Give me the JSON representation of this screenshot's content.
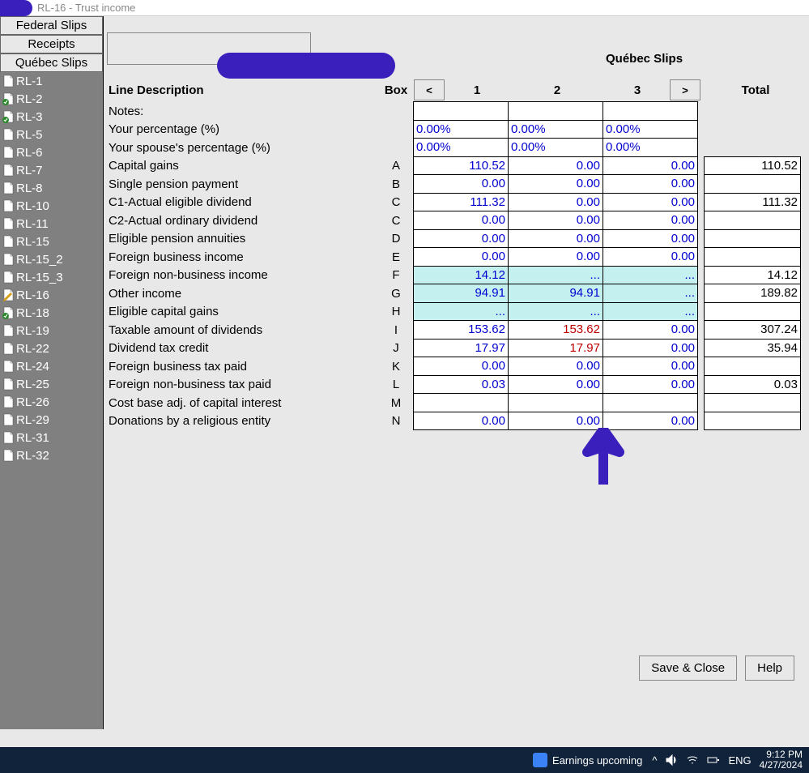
{
  "window": {
    "title": "RL-16  -  Trust income"
  },
  "sidebar": {
    "buttons": [
      {
        "label": "Federal Slips"
      },
      {
        "label": "Receipts"
      },
      {
        "label": "Québec Slips"
      }
    ],
    "items": [
      {
        "label": "RL-1",
        "state": "plain"
      },
      {
        "label": "RL-2",
        "state": "check"
      },
      {
        "label": "RL-3",
        "state": "check"
      },
      {
        "label": "RL-5",
        "state": "plain"
      },
      {
        "label": "RL-6",
        "state": "plain"
      },
      {
        "label": "RL-7",
        "state": "plain"
      },
      {
        "label": "RL-8",
        "state": "plain"
      },
      {
        "label": "RL-10",
        "state": "plain"
      },
      {
        "label": "RL-11",
        "state": "plain"
      },
      {
        "label": "RL-15",
        "state": "plain"
      },
      {
        "label": "RL-15_2",
        "state": "plain"
      },
      {
        "label": "RL-15_3",
        "state": "plain"
      },
      {
        "label": "RL-16",
        "state": "edit"
      },
      {
        "label": "RL-18",
        "state": "check"
      },
      {
        "label": "RL-19",
        "state": "plain"
      },
      {
        "label": "RL-22",
        "state": "plain"
      },
      {
        "label": "RL-24",
        "state": "plain"
      },
      {
        "label": "RL-25",
        "state": "plain"
      },
      {
        "label": "RL-26",
        "state": "plain"
      },
      {
        "label": "RL-29",
        "state": "plain"
      },
      {
        "label": "RL-31",
        "state": "plain"
      },
      {
        "label": "RL-32",
        "state": "plain"
      }
    ]
  },
  "header": {
    "slips_title": "Québec Slips",
    "desc_header": "Line Description",
    "box_header": "Box",
    "prev": "<",
    "next": ">",
    "cols": [
      "1",
      "2",
      "3"
    ],
    "total_header": "Total"
  },
  "rows": [
    {
      "desc": "Notes:",
      "box": "",
      "cells": [
        {
          "v": "",
          "t": "empty"
        },
        {
          "v": "",
          "t": "empty"
        },
        {
          "v": "",
          "t": "empty"
        }
      ],
      "total": ""
    },
    {
      "desc": "Your percentage (%)",
      "box": "",
      "cells": [
        {
          "v": "0.00%",
          "t": "left"
        },
        {
          "v": "0.00%",
          "t": "left"
        },
        {
          "v": "0.00%",
          "t": "left"
        }
      ],
      "total": ""
    },
    {
      "desc": "Your spouse's percentage (%)",
      "box": "",
      "cells": [
        {
          "v": "0.00%",
          "t": "left"
        },
        {
          "v": "0.00%",
          "t": "left"
        },
        {
          "v": "0.00%",
          "t": "left"
        }
      ],
      "total": ""
    },
    {
      "desc": "Capital gains",
      "box": "A",
      "cells": [
        {
          "v": "110.52"
        },
        {
          "v": "0.00"
        },
        {
          "v": "0.00"
        }
      ],
      "total": "110.52"
    },
    {
      "desc": "Single pension payment",
      "box": "B",
      "cells": [
        {
          "v": "0.00"
        },
        {
          "v": "0.00"
        },
        {
          "v": "0.00"
        }
      ],
      "total": ""
    },
    {
      "desc": "C1-Actual eligible dividend",
      "box": "C",
      "cells": [
        {
          "v": "111.32"
        },
        {
          "v": "0.00"
        },
        {
          "v": "0.00"
        }
      ],
      "total": "111.32"
    },
    {
      "desc": "C2-Actual ordinary dividend",
      "box": "C",
      "cells": [
        {
          "v": "0.00"
        },
        {
          "v": "0.00"
        },
        {
          "v": "0.00"
        }
      ],
      "total": ""
    },
    {
      "desc": "Eligible pension annuities",
      "box": "D",
      "cells": [
        {
          "v": "0.00"
        },
        {
          "v": "0.00"
        },
        {
          "v": "0.00"
        }
      ],
      "total": ""
    },
    {
      "desc": "Foreign business income",
      "box": "E",
      "cells": [
        {
          "v": "0.00"
        },
        {
          "v": "0.00"
        },
        {
          "v": "0.00"
        }
      ],
      "total": ""
    },
    {
      "desc": "Foreign non-business income",
      "box": "F",
      "cells": [
        {
          "v": "14.12",
          "t": "hl"
        },
        {
          "v": "...",
          "t": "hl"
        },
        {
          "v": "...",
          "t": "hl"
        }
      ],
      "total": "14.12"
    },
    {
      "desc": "Other income",
      "box": "G",
      "cells": [
        {
          "v": "94.91",
          "t": "hl"
        },
        {
          "v": "94.91",
          "t": "hl"
        },
        {
          "v": "...",
          "t": "hl"
        }
      ],
      "total": "189.82"
    },
    {
      "desc": "Eligible capital gains",
      "box": "H",
      "cells": [
        {
          "v": "...",
          "t": "hl"
        },
        {
          "v": "...",
          "t": "hl"
        },
        {
          "v": "...",
          "t": "hl"
        }
      ],
      "total": ""
    },
    {
      "desc": "Taxable amount of dividends",
      "box": "I",
      "cells": [
        {
          "v": "153.62"
        },
        {
          "v": "153.62",
          "t": "neg"
        },
        {
          "v": "0.00"
        }
      ],
      "total": "307.24"
    },
    {
      "desc": "Dividend tax credit",
      "box": "J",
      "cells": [
        {
          "v": "17.97"
        },
        {
          "v": "17.97",
          "t": "neg"
        },
        {
          "v": "0.00"
        }
      ],
      "total": "35.94"
    },
    {
      "desc": "Foreign business tax paid",
      "box": "K",
      "cells": [
        {
          "v": "0.00"
        },
        {
          "v": "0.00"
        },
        {
          "v": "0.00"
        }
      ],
      "total": ""
    },
    {
      "desc": "Foreign non-business tax paid",
      "box": "L",
      "cells": [
        {
          "v": "0.03"
        },
        {
          "v": "0.00"
        },
        {
          "v": "0.00"
        }
      ],
      "total": "0.03"
    },
    {
      "desc": "Cost base adj. of capital interest",
      "box": "M",
      "cells": [
        {
          "v": "",
          "t": "empty"
        },
        {
          "v": "",
          "t": "empty"
        },
        {
          "v": "",
          "t": "empty"
        }
      ],
      "total": ""
    },
    {
      "desc": "Donations by a religious entity",
      "box": "N",
      "cells": [
        {
          "v": "0.00"
        },
        {
          "v": "0.00"
        },
        {
          "v": "0.00"
        }
      ],
      "total": ""
    }
  ],
  "footer": {
    "save_close": "Save & Close",
    "help": "Help"
  },
  "taskbar": {
    "earnings": "Earnings upcoming",
    "lang": "ENG",
    "time": "9:12 PM",
    "date": "4/27/2024"
  }
}
